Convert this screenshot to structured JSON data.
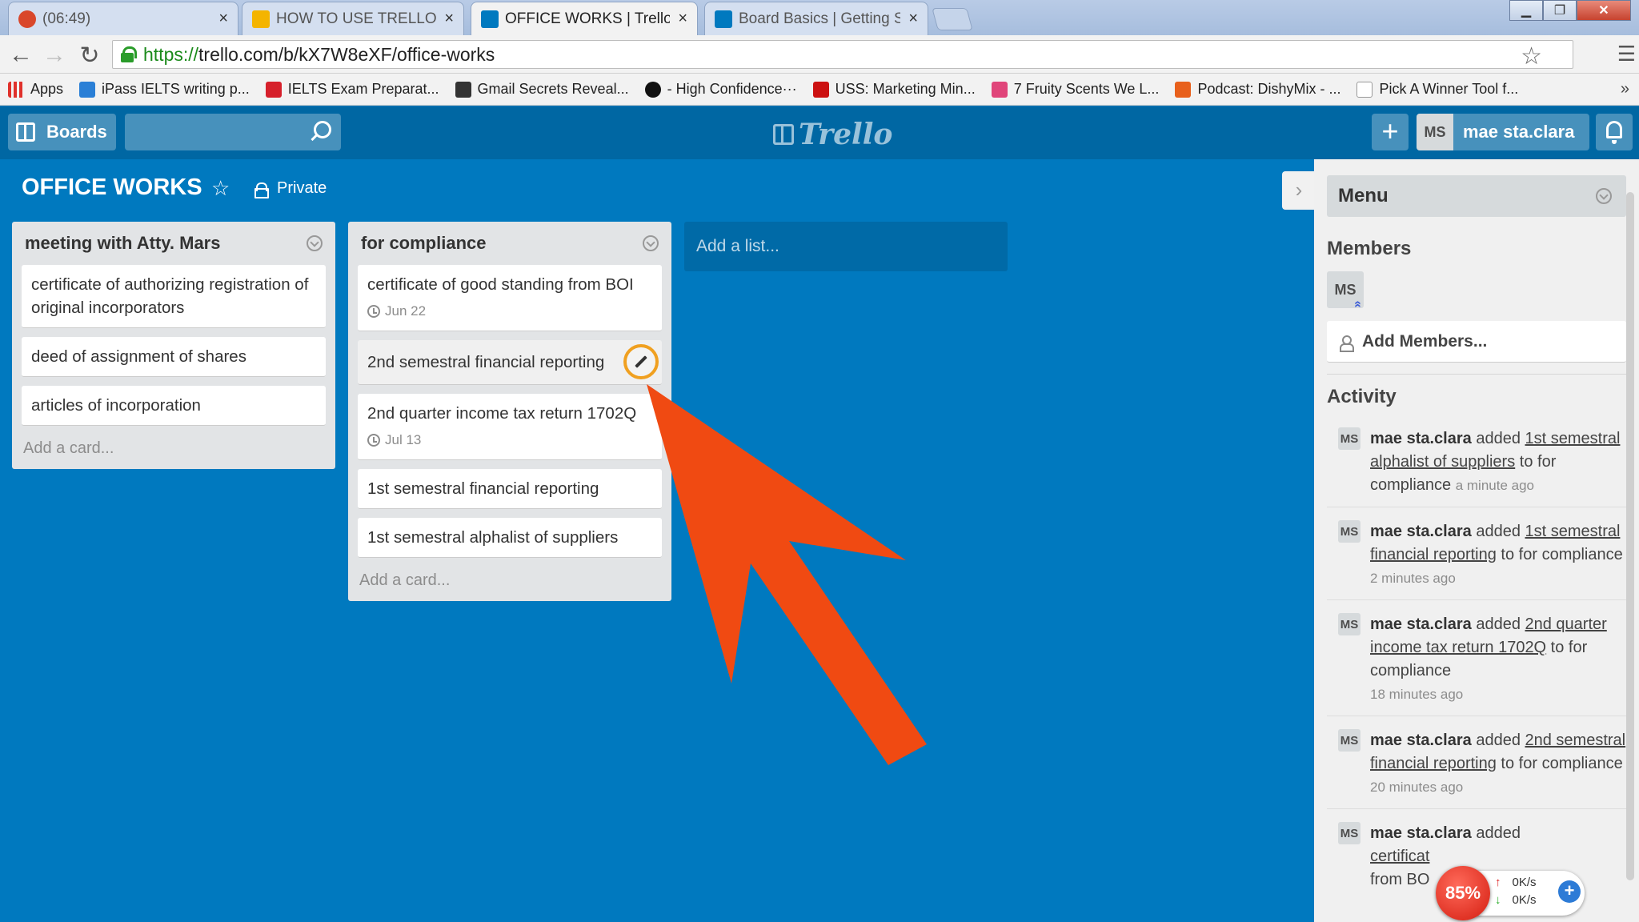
{
  "browser": {
    "tabs": [
      {
        "label": "(06:49)",
        "active": false,
        "favicon_color": "#d9472b"
      },
      {
        "label": "HOW TO USE TRELLO - Go",
        "active": false,
        "favicon_color": "#f4b400"
      },
      {
        "label": "OFFICE WORKS | Trello",
        "active": true,
        "favicon_color": "#0079bf"
      },
      {
        "label": "Board Basics | Getting Star",
        "active": false,
        "favicon_color": "#0079bf"
      }
    ],
    "url_https": "https://",
    "url_rest": "trello.com/b/kX7W8eXF/office-works",
    "bookmarks": [
      {
        "label": "Apps",
        "icon_color": "#e0312b"
      },
      {
        "label": "iPass IELTS writing p...",
        "icon_color": "#2a7fd6"
      },
      {
        "label": "IELTS Exam Preparat...",
        "icon_color": "#d6202b"
      },
      {
        "label": "Gmail Secrets Reveal...",
        "icon_color": "#333333"
      },
      {
        "label": "- High Confidence···",
        "icon_color": "#111111"
      },
      {
        "label": "USS: Marketing Min...",
        "icon_color": "#cc1111"
      },
      {
        "label": "7 Fruity Scents We L...",
        "icon_color": "#e0457a"
      },
      {
        "label": "Podcast: DishyMix - ...",
        "icon_color": "#e8601c"
      },
      {
        "label": "Pick A Winner Tool f...",
        "icon_color": "#dddddd"
      }
    ],
    "more": "»"
  },
  "header": {
    "boards_label": "Boards",
    "logo_text": "Trello",
    "plus": "+",
    "user_initials": "MS",
    "user_name": "mae sta.clara"
  },
  "board": {
    "title": "OFFICE WORKS",
    "star": "☆",
    "privacy": "Private"
  },
  "lists": [
    {
      "title": "meeting with Atty. Mars",
      "cards": [
        {
          "text": "certificate of authorizing registration of original incorporators"
        },
        {
          "text": "deed of assignment of shares"
        },
        {
          "text": "articles of incorporation"
        }
      ],
      "add_card": "Add a card..."
    },
    {
      "title": "for compliance",
      "cards": [
        {
          "text": "certificate of good standing from BOI",
          "due": "Jun 22"
        },
        {
          "text": "2nd semestral financial reporting"
        },
        {
          "text": "2nd quarter income tax return 1702Q",
          "due": "Jul 13"
        },
        {
          "text": "1st semestral financial reporting"
        },
        {
          "text": "1st semestral alphalist of suppliers"
        }
      ],
      "add_card": "Add a card..."
    }
  ],
  "add_list": "Add a list...",
  "sidebar": {
    "toggle": "›",
    "menu_title": "Menu",
    "members_title": "Members",
    "member_initials": "MS",
    "add_members": "Add Members...",
    "activity_title": "Activity",
    "activity": [
      {
        "initials": "MS",
        "who": "mae sta.clara",
        "verb": " added ",
        "link": "1st semestral alphalist of suppliers",
        "rest": " to for compliance ",
        "time": "a minute ago"
      },
      {
        "initials": "MS",
        "who": "mae sta.clara",
        "verb": " added ",
        "link": "1st semestral financial reporting",
        "rest": " to for compliance ",
        "time": "2 minutes ago"
      },
      {
        "initials": "MS",
        "who": "mae sta.clara",
        "verb": " added ",
        "link": "2nd quarter income tax return 1702Q",
        "rest": " to for compliance ",
        "time": "18 minutes ago"
      },
      {
        "initials": "MS",
        "who": "mae sta.clara",
        "verb": " added ",
        "link": "2nd semestral financial reporting",
        "rest": " to for compliance ",
        "time": "20 minutes ago"
      },
      {
        "initials": "MS",
        "who": "mae sta.clara",
        "verb": " added ",
        "link": "certificat",
        "rest": " from BO",
        "time": ""
      }
    ]
  },
  "network_widget": {
    "percent": "85%",
    "up": "0K/s",
    "down": "0K/s"
  },
  "colors": {
    "board_bg": "#0079bf",
    "header_bg": "#0067a3",
    "arrow": "#f04a12",
    "highlight_ring": "#f0a020"
  }
}
